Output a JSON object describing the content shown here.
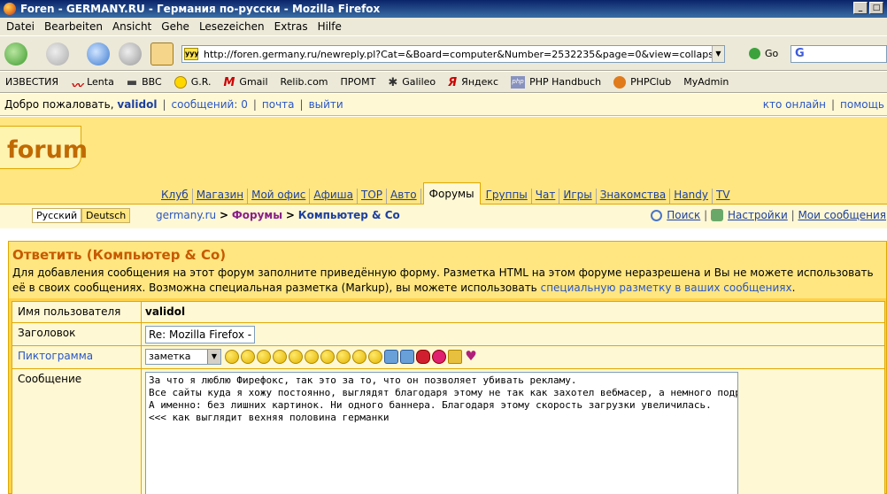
{
  "window": {
    "title": "Foren - GERMANY.RU - Германия по-русски - Mozilla Firefox"
  },
  "menu": [
    "Datei",
    "Bearbeiten",
    "Ansicht",
    "Gehe",
    "Lesezeichen",
    "Extras",
    "Hilfe"
  ],
  "address": {
    "url": "http://foren.germany.ru/newreply.pl?Cat=&Board=computer&Number=2532235&page=0&view=collapsed&what=showf",
    "go_label": "Go"
  },
  "bookmarks": [
    "ИЗВЕСТИЯ",
    "Lenta",
    "BBC",
    "G.R.",
    "Gmail",
    "Relib.com",
    "ПРОМТ",
    "Galileo",
    "Яндекс",
    "PHP Handbuch",
    "PHPClub",
    "MyAdmin"
  ],
  "userbar": {
    "welcome": "Добро пожаловать,",
    "username": "validol",
    "messages": "сообщений: 0",
    "mail": "почта",
    "logout": "выйти",
    "online": "кто онлайн",
    "help": "помощь"
  },
  "logo": "forum",
  "tabs": [
    "Клуб",
    "Магазин",
    "Мой офис",
    "Афиша",
    "TOP",
    "Авто",
    "Форумы",
    "Группы",
    "Чат",
    "Игры",
    "Знакомства",
    "Handy",
    "TV"
  ],
  "lang": {
    "ru": "Русский",
    "de": "Deutsch"
  },
  "breadcrumb": {
    "site": "germany.ru",
    "forums": "Форумы",
    "section": "Компьютер & Co",
    "sep": ">"
  },
  "tools": {
    "search": "Поиск",
    "settings": "Настройки",
    "mymessages": "Мои сообщения"
  },
  "form": {
    "title": "Ответить (Компьютер & Co)",
    "desc": "Для добавления сообщения на этот форум заполните приведённую форму. Разметка HTML на этом форуме неразрешена и Вы не можете использовать её в своих сообщениях. Возможна специальная разметка (Markup), вы можете использовать",
    "desc_link": "специальную разметку в ваших сообщениях",
    "username_label": "Имя пользователя",
    "username_value": "validol",
    "subject_label": "Заголовок",
    "subject_value": "Re: Mozilla Firefox - за",
    "icon_label": "Пиктограмма",
    "icon_select": "заметка",
    "message_label": "Сообщение",
    "message_text": "За что я люблю Фирефокс, так это за то, что он позволяет убивать рекламу.\nВсе сайты куда я хожу постоянно, выглядят благодаря этому не так как захотел вебмасер, а немного подругому.\nА именно: без лишних картинок. Ни одного баннера. Благодаря этому скорость загрузки увеличилась.\n<<< как выглядит вехняя половина германки"
  }
}
